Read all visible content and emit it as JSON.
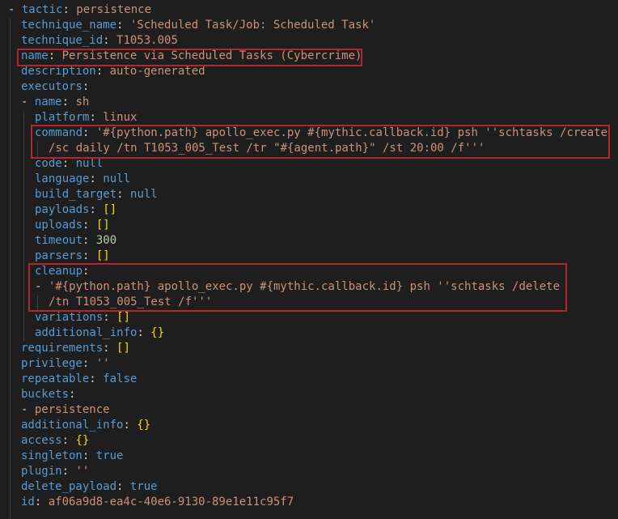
{
  "editor": {
    "colors": {
      "background": "#1e1e1e",
      "key": "#569cd6",
      "string_value": "#ce9178",
      "number_value": "#b5cea8",
      "punctuation": "#d4d4d4",
      "bracket": "#ffd700",
      "highlight_box": "#b3262c"
    },
    "lines": [
      {
        "tokens": [
          {
            "t": "- ",
            "c": "p"
          },
          {
            "t": "tactic",
            "c": "k"
          },
          {
            "t": ": ",
            "c": "p"
          },
          {
            "t": "persistence",
            "c": "v"
          }
        ]
      },
      {
        "tokens": [
          {
            "t": "technique_name",
            "c": "k"
          },
          {
            "t": ": ",
            "c": "p"
          },
          {
            "t": "'Scheduled Task/Job: Scheduled Task'",
            "c": "v"
          }
        ]
      },
      {
        "tokens": [
          {
            "t": "technique_id",
            "c": "k"
          },
          {
            "t": ": ",
            "c": "p"
          },
          {
            "t": "T1053.005",
            "c": "v"
          }
        ]
      },
      {
        "tokens": [
          {
            "t": "name",
            "c": "k"
          },
          {
            "t": ": ",
            "c": "p"
          },
          {
            "t": "Persistence via Scheduled Tasks (Cybercrime)",
            "c": "v"
          }
        ]
      },
      {
        "tokens": [
          {
            "t": "description",
            "c": "k"
          },
          {
            "t": ": ",
            "c": "p"
          },
          {
            "t": "auto-generated",
            "c": "v"
          }
        ]
      },
      {
        "tokens": [
          {
            "t": "executors",
            "c": "k"
          },
          {
            "t": ":",
            "c": "p"
          }
        ]
      },
      {
        "tokens": [
          {
            "t": "- ",
            "c": "p"
          },
          {
            "t": "name",
            "c": "k"
          },
          {
            "t": ": ",
            "c": "p"
          },
          {
            "t": "sh",
            "c": "v"
          }
        ]
      },
      {
        "tokens": [
          {
            "t": "platform",
            "c": "k"
          },
          {
            "t": ": ",
            "c": "p"
          },
          {
            "t": "linux",
            "c": "v"
          }
        ]
      },
      {
        "tokens": [
          {
            "t": "command",
            "c": "k"
          },
          {
            "t": ": ",
            "c": "p"
          },
          {
            "t": "'#{python.path} apollo_exec.py #{mythic.callback.id} psh ''schtasks /create",
            "c": "v"
          }
        ]
      },
      {
        "tokens": [
          {
            "t": "/sc daily /tn T1053_005_Test /tr \"#{agent.path}\" /st 20:00 /f'''",
            "c": "v"
          }
        ]
      },
      {
        "tokens": [
          {
            "t": "code",
            "c": "k"
          },
          {
            "t": ": ",
            "c": "p"
          },
          {
            "t": "null",
            "c": "k"
          }
        ]
      },
      {
        "tokens": [
          {
            "t": "language",
            "c": "k"
          },
          {
            "t": ": ",
            "c": "p"
          },
          {
            "t": "null",
            "c": "k"
          }
        ]
      },
      {
        "tokens": [
          {
            "t": "build_target",
            "c": "k"
          },
          {
            "t": ": ",
            "c": "p"
          },
          {
            "t": "null",
            "c": "k"
          }
        ]
      },
      {
        "tokens": [
          {
            "t": "payloads",
            "c": "k"
          },
          {
            "t": ": ",
            "c": "p"
          },
          {
            "t": "[]",
            "c": "b"
          }
        ]
      },
      {
        "tokens": [
          {
            "t": "uploads",
            "c": "k"
          },
          {
            "t": ": ",
            "c": "p"
          },
          {
            "t": "[]",
            "c": "b"
          }
        ]
      },
      {
        "tokens": [
          {
            "t": "timeout",
            "c": "k"
          },
          {
            "t": ": ",
            "c": "p"
          },
          {
            "t": "300",
            "c": "n"
          }
        ]
      },
      {
        "tokens": [
          {
            "t": "parsers",
            "c": "k"
          },
          {
            "t": ": ",
            "c": "p"
          },
          {
            "t": "[]",
            "c": "b"
          }
        ]
      },
      {
        "tokens": [
          {
            "t": "cleanup",
            "c": "k"
          },
          {
            "t": ":",
            "c": "p"
          }
        ]
      },
      {
        "tokens": [
          {
            "t": "- ",
            "c": "p"
          },
          {
            "t": "'#{python.path} apollo_exec.py #{mythic.callback.id} psh ''schtasks /delete",
            "c": "v"
          }
        ]
      },
      {
        "tokens": [
          {
            "t": "/tn T1053_005_Test /f'''",
            "c": "v"
          }
        ]
      },
      {
        "tokens": [
          {
            "t": "variations",
            "c": "k"
          },
          {
            "t": ": ",
            "c": "p"
          },
          {
            "t": "[]",
            "c": "b"
          }
        ]
      },
      {
        "tokens": [
          {
            "t": "additional_info",
            "c": "k"
          },
          {
            "t": ": ",
            "c": "p"
          },
          {
            "t": "{}",
            "c": "b"
          }
        ]
      },
      {
        "tokens": [
          {
            "t": "requirements",
            "c": "k"
          },
          {
            "t": ": ",
            "c": "p"
          },
          {
            "t": "[]",
            "c": "b"
          }
        ]
      },
      {
        "tokens": [
          {
            "t": "privilege",
            "c": "k"
          },
          {
            "t": ": ",
            "c": "p"
          },
          {
            "t": "''",
            "c": "v"
          }
        ]
      },
      {
        "tokens": [
          {
            "t": "repeatable",
            "c": "k"
          },
          {
            "t": ": ",
            "c": "p"
          },
          {
            "t": "false",
            "c": "k"
          }
        ]
      },
      {
        "tokens": [
          {
            "t": "buckets",
            "c": "k"
          },
          {
            "t": ":",
            "c": "p"
          }
        ]
      },
      {
        "tokens": [
          {
            "t": "- ",
            "c": "p"
          },
          {
            "t": "persistence",
            "c": "v"
          }
        ]
      },
      {
        "tokens": [
          {
            "t": "additional_info",
            "c": "k"
          },
          {
            "t": ": ",
            "c": "p"
          },
          {
            "t": "{}",
            "c": "b"
          }
        ]
      },
      {
        "tokens": [
          {
            "t": "access",
            "c": "k"
          },
          {
            "t": ": ",
            "c": "p"
          },
          {
            "t": "{}",
            "c": "b"
          }
        ]
      },
      {
        "tokens": [
          {
            "t": "singleton",
            "c": "k"
          },
          {
            "t": ": ",
            "c": "p"
          },
          {
            "t": "true",
            "c": "k"
          }
        ]
      },
      {
        "tokens": [
          {
            "t": "plugin",
            "c": "k"
          },
          {
            "t": ": ",
            "c": "p"
          },
          {
            "t": "''",
            "c": "v"
          }
        ]
      },
      {
        "tokens": [
          {
            "t": "delete_payload",
            "c": "k"
          },
          {
            "t": ": ",
            "c": "p"
          },
          {
            "t": "true",
            "c": "k"
          }
        ]
      },
      {
        "tokens": [
          {
            "t": "id",
            "c": "k"
          },
          {
            "t": ": ",
            "c": "p"
          },
          {
            "t": "af06a9d8-ea4c-40e6-9130-89e1e11c95f7",
            "c": "v"
          }
        ]
      }
    ]
  }
}
